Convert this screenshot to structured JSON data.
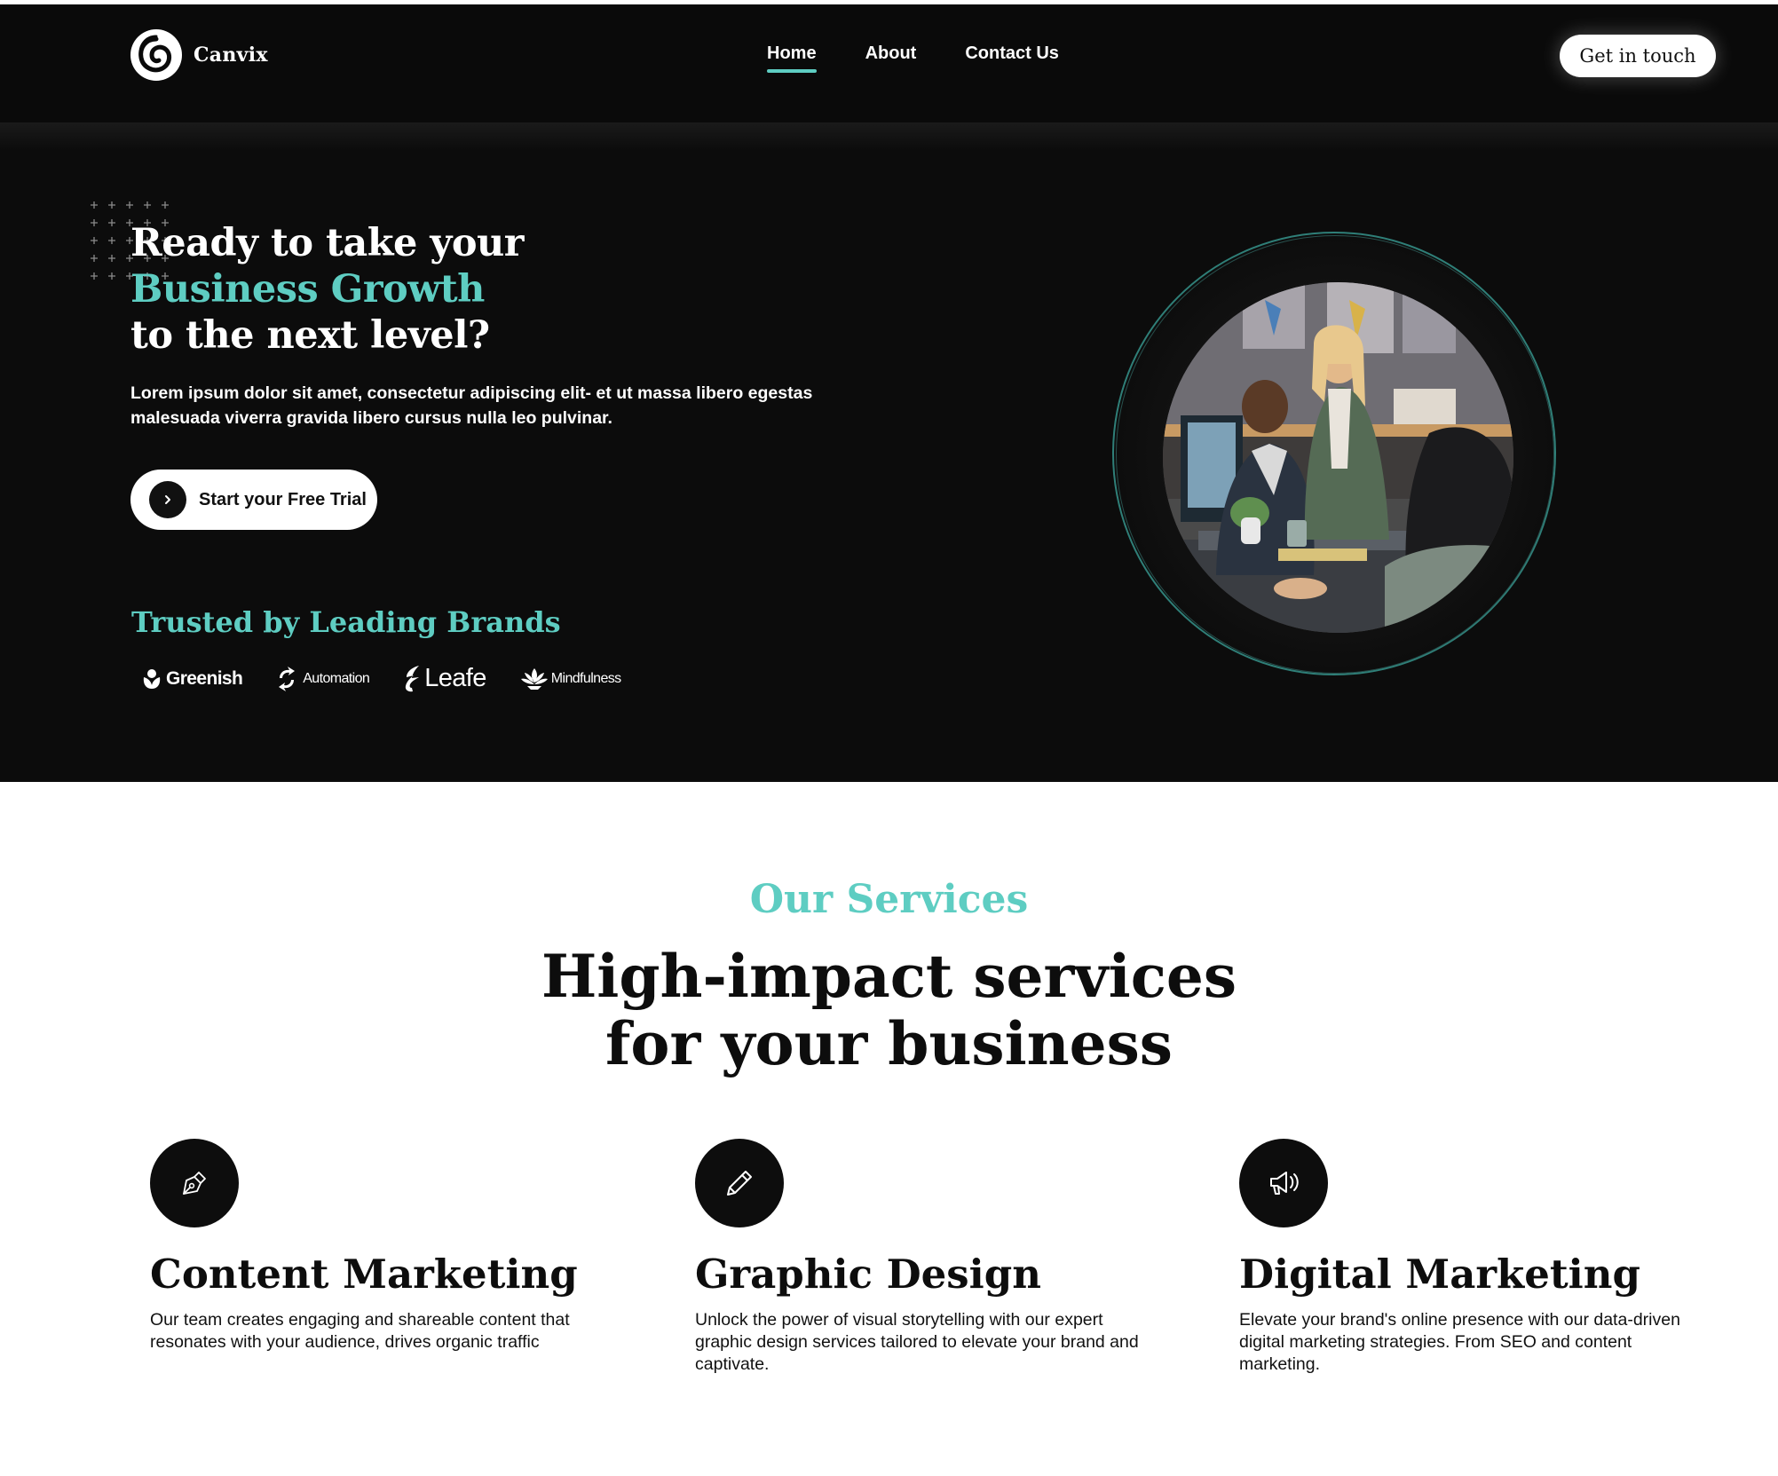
{
  "colors": {
    "accent": "#5ecdc2",
    "dark": "#0c0c0c",
    "white": "#ffffff"
  },
  "nav": {
    "brand": "Canvix",
    "links": [
      {
        "label": "Home",
        "active": true
      },
      {
        "label": "About",
        "active": false
      },
      {
        "label": "Contact Us",
        "active": false
      }
    ],
    "cta": "Get in touch"
  },
  "hero": {
    "title_line1": "Ready to take your",
    "title_line2": "Business Growth",
    "title_line3": "to the next level?",
    "description": "Lorem ipsum dolor sit amet, consectetur adipiscing elit- et ut massa libero egestas malesuada viverra gravida libero cursus nulla leo pulvinar.",
    "button": "Start your Free Trial",
    "trusted_heading": "Trusted by Leading Brands",
    "brands": [
      "Greenish",
      "Automation",
      "Leafe",
      "Mindfulness"
    ]
  },
  "services": {
    "kicker": "Our Services",
    "title_line1": "High-impact services",
    "title_line2": "for your business",
    "items": [
      {
        "icon": "pen-nib-icon",
        "title": "Content Marketing",
        "description": "Our team creates engaging and shareable content that resonates with your audience, drives organic traffic"
      },
      {
        "icon": "pencil-icon",
        "title": "Graphic Design",
        "description": "Unlock the power of visual storytelling with our expert graphic design services tailored to elevate your brand and captivate."
      },
      {
        "icon": "megaphone-icon",
        "title": "Digital Marketing",
        "description": "Elevate your brand's online presence with our data-driven digital marketing strategies. From SEO and content marketing."
      }
    ]
  }
}
